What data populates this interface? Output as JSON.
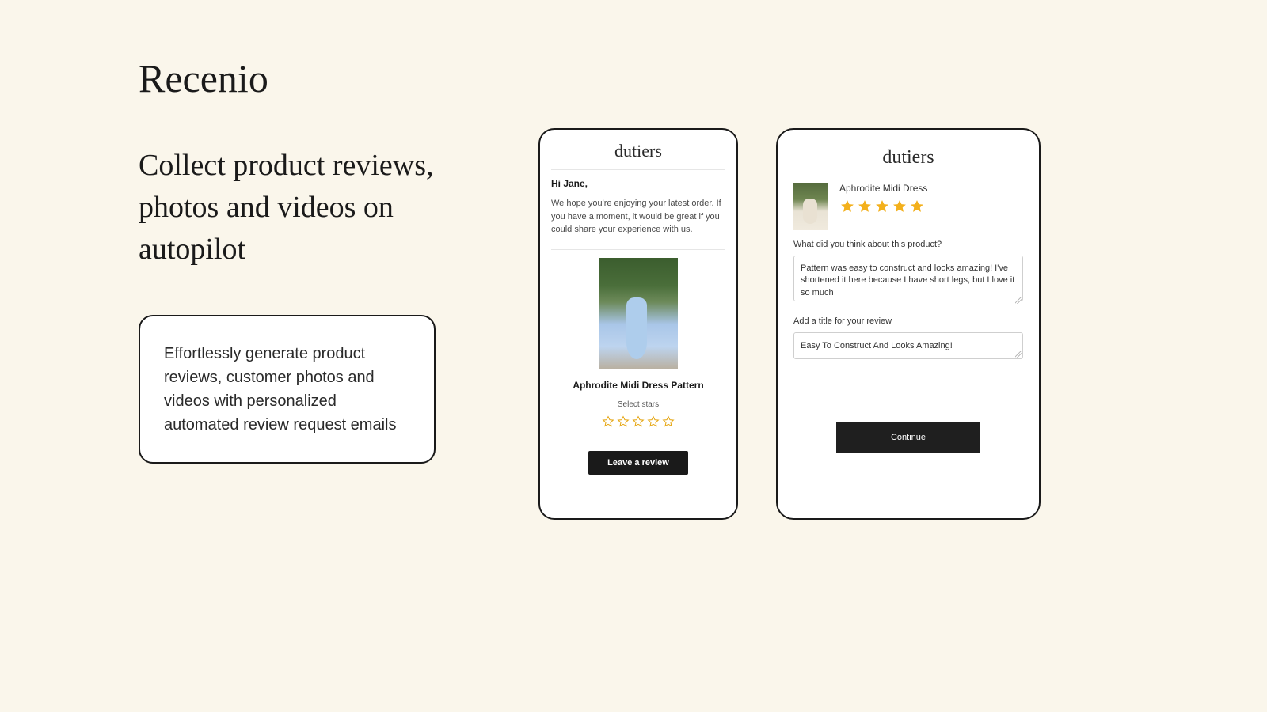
{
  "brand": "Recenio",
  "headline": "Collect product reviews, photos and videos on autopilot",
  "description": "Effortlessly generate product reviews, customer photos and videos with personalized automated review request emails",
  "email_card": {
    "store_logo": "dutiers",
    "greeting": "Hi Jane,",
    "body": "We hope you're enjoying your latest order. If you have a moment, it would be great if you could share your experience with us.",
    "product_name": "Aphrodite Midi Dress Pattern",
    "select_stars": "Select stars",
    "cta": "Leave a review"
  },
  "review_card": {
    "store_logo": "dutiers",
    "product_name": "Aphrodite Midi Dress",
    "rating": 5,
    "q1_label": "What did you think about this product?",
    "q1_value": "Pattern was easy to construct and looks amazing! I've shortened it here because I have short legs, but I love it so much",
    "q2_label": "Add a title for your review",
    "q2_value": "Easy To Construct And Looks Amazing!",
    "cta": "Continue"
  },
  "colors": {
    "star_filled": "#f3b01c",
    "star_outline": "#e6a817"
  }
}
